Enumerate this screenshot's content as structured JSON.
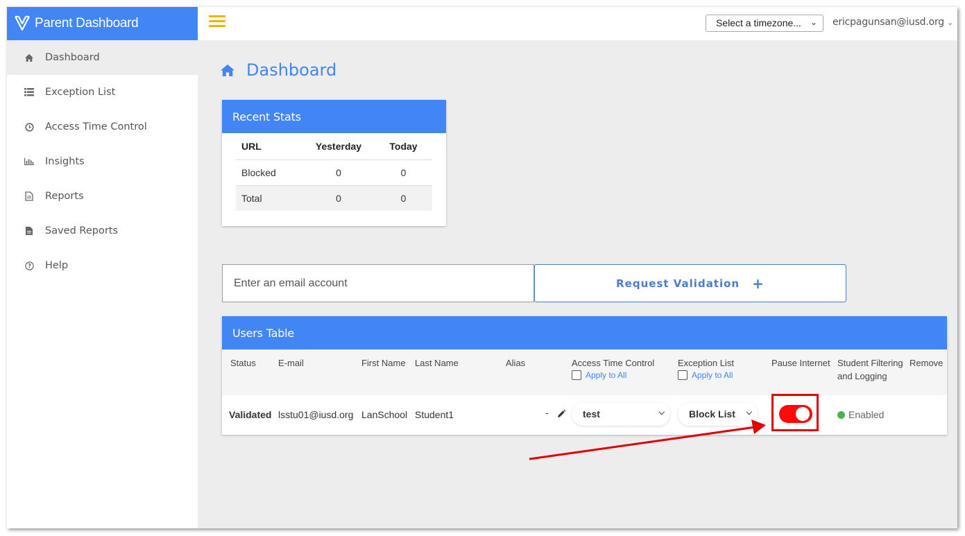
{
  "brand": {
    "title": "Parent Dashboard",
    "logo_icon": "parent-dashboard-logo"
  },
  "topbar": {
    "menu_icon": "hamburger-icon",
    "timezone": {
      "selected": "Select a timezone..."
    },
    "user_email": "ericpagunsan@iusd.org"
  },
  "sidebar": {
    "items": [
      {
        "label": "Dashboard",
        "icon": "home-icon",
        "active": true
      },
      {
        "label": "Exception List",
        "icon": "list-icon"
      },
      {
        "label": "Access Time Control",
        "icon": "clock-icon"
      },
      {
        "label": "Insights",
        "icon": "bar-chart-icon"
      },
      {
        "label": "Reports",
        "icon": "document-icon"
      },
      {
        "label": "Saved Reports",
        "icon": "saved-document-icon"
      },
      {
        "label": "Help",
        "icon": "help-icon"
      }
    ]
  },
  "main": {
    "title": "Dashboard",
    "title_icon": "home-icon",
    "recent_stats": {
      "header": "Recent Stats",
      "columns": [
        "URL",
        "Yesterday",
        "Today"
      ],
      "rows": [
        [
          "Blocked",
          "0",
          "0"
        ],
        [
          "Total",
          "0",
          "0"
        ]
      ]
    },
    "email_input": {
      "placeholder": "Enter an email account",
      "value": ""
    },
    "request_button": {
      "label": "Request Validation",
      "icon": "plus-icon"
    },
    "users_table": {
      "header": "Users Table",
      "columns": {
        "status": "Status",
        "email": "E-mail",
        "first_name": "First Name",
        "last_name": "Last Name",
        "alias": "Alias",
        "access_time_control": "Access Time Control",
        "exception_list": "Exception List",
        "pause_internet": "Pause Internet",
        "student_filtering_1": "Student Filtering",
        "student_filtering_2": "and Logging",
        "remove": "Remove"
      },
      "apply_to_all": "Apply to All",
      "row": {
        "status": "Validated",
        "email": "lsstu01@iusd.org",
        "first_name": "LanSchool",
        "last_name": "Student1",
        "alias": "-",
        "access_time_control": "test",
        "exception_list": "Block List",
        "pause_internet_on": true,
        "student_filtering": "Enabled"
      }
    }
  },
  "colors": {
    "accent": "#4285f4",
    "toggle_on": "#ff0a0a",
    "validated": "#4caf50",
    "annotation": "#e00000",
    "menu": "#f0b400"
  }
}
